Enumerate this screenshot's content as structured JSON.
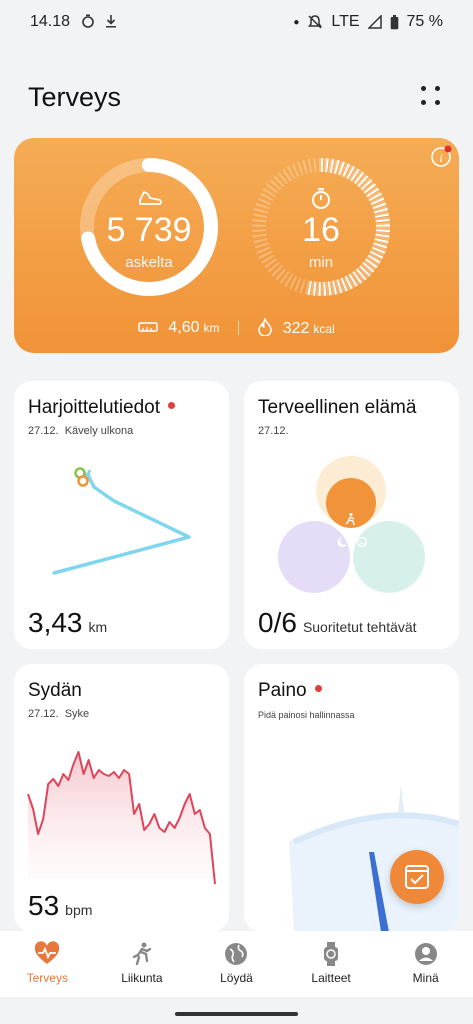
{
  "status": {
    "time": "14.18",
    "network": "LTE",
    "battery": "75 %"
  },
  "header": {
    "title": "Terveys"
  },
  "activity": {
    "steps_value": "5 739",
    "steps_label": "askelta",
    "steps_progress": 0.72,
    "minutes_value": "16",
    "minutes_label": "min",
    "minutes_progress": 0.55,
    "distance_value": "4,60",
    "distance_unit": "km",
    "calories_value": "322",
    "calories_unit": "kcal"
  },
  "exercise_card": {
    "title": "Harjoittelutiedot",
    "date": "27.12.",
    "activity": "Kävely ulkona",
    "value": "3,43",
    "unit": "km"
  },
  "healthy_card": {
    "title": "Terveellinen elämä",
    "date": "27.12.",
    "value": "0/6",
    "caption": "Suoritetut tehtävät"
  },
  "heart_card": {
    "title": "Sydän",
    "date": "27.12.",
    "metric": "Syke",
    "value": "53",
    "unit": "bpm"
  },
  "weight_card": {
    "title": "Paino",
    "subtitle": "Pidä painosi hallinnassa"
  },
  "nav": {
    "items": [
      {
        "label": "Terveys",
        "icon": "heart-icon",
        "active": true
      },
      {
        "label": "Liikunta",
        "icon": "running-icon",
        "active": false
      },
      {
        "label": "Löydä",
        "icon": "globe-icon",
        "active": false
      },
      {
        "label": "Laitteet",
        "icon": "watch-icon",
        "active": false
      },
      {
        "label": "Minä",
        "icon": "person-icon",
        "active": false
      }
    ]
  },
  "colors": {
    "accent": "#f19338",
    "active_nav": "#e8773b",
    "route": "#7fd6ee",
    "heart_line": "#e0445a"
  }
}
